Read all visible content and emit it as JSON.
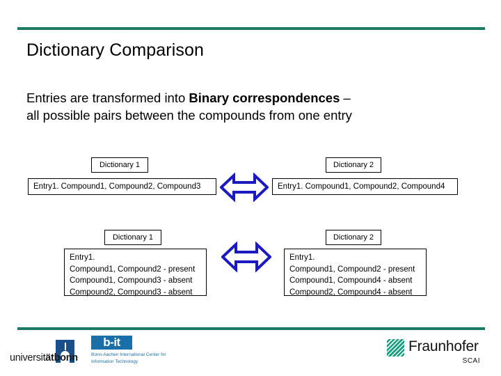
{
  "slide": {
    "title": "Dictionary Comparison",
    "body": {
      "lead": "Entries are transformed into ",
      "emphasis": "Binary correspondences",
      "trail": " –",
      "line2": "all possible pairs between the compounds from one entry"
    },
    "accent_color": "#1c7a63"
  },
  "diagram": {
    "arrow_color": "#1a1aC0",
    "row1": {
      "left": {
        "label": "Dictionary 1",
        "entry": "Entry1. Compound1, Compound2, Compound3"
      },
      "right": {
        "label": "Dictionary 2",
        "entry": "Entry1. Compound1, Compound2, Compound4"
      },
      "arrow": "double-headed-horizontal-arrow"
    },
    "row2": {
      "left": {
        "label": "Dictionary 1",
        "lines": [
          "Entry1.",
          "Compound1, Compound2 - present",
          "Compound1, Compound3 - absent",
          "Compound2, Compound3 - absent"
        ]
      },
      "right": {
        "label": "Dictionary 2",
        "lines": [
          "Entry1.",
          "Compound1, Compound2 - present",
          "Compound1, Compound4 - absent",
          "Compound2, Compound4 - absent"
        ]
      },
      "arrow": "double-headed-horizontal-arrow"
    }
  },
  "footer": {
    "uni_bonn": {
      "word_light": "universit",
      "word_bold": "ätbonn",
      "crest_color": "#1b4f8a"
    },
    "bit": {
      "mark": "b-it",
      "caption_line1": "Bonn-Aachen International Center for",
      "caption_line2": "Information Technology",
      "color": "#1a6fa8"
    },
    "fraunhofer": {
      "name": "Fraunhofer",
      "institute": "SCAI",
      "color": "#179c7d"
    }
  }
}
